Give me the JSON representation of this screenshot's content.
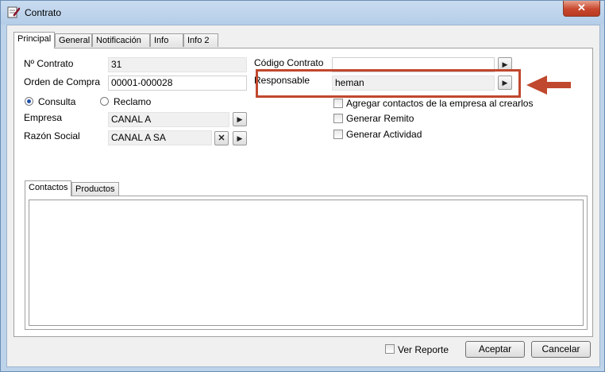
{
  "window": {
    "title": "Contrato",
    "close_glyph": "✕"
  },
  "tabs": [
    "Principal",
    "General",
    "Notificación",
    "Info",
    "Info 2"
  ],
  "fields": {
    "nro_contrato_label": "Nº Contrato",
    "nro_contrato_value": "31",
    "orden_compra_label": "Orden de Compra",
    "orden_compra_value": "00001-000028",
    "codigo_contrato_label": "Código Contrato",
    "codigo_contrato_value": "",
    "responsable_label": "Responsable",
    "responsable_value": "heman",
    "empresa_label": "Empresa",
    "empresa_value": "CANAL A",
    "razon_social_label": "Razón Social",
    "razon_social_value": "CANAL A SA"
  },
  "radios": {
    "consulta": "Consulta",
    "reclamo": "Reclamo",
    "selected": "consulta"
  },
  "checkboxes": {
    "agregar_contactos": "Agregar contactos de la empresa al crearlos",
    "generar_remito": "Generar Remito",
    "generar_actividad": "Generar Actividad"
  },
  "subtabs": [
    "Contactos",
    "Productos"
  ],
  "footer": {
    "ver_reporte": "Ver Reporte",
    "aceptar": "Aceptar",
    "cancelar": "Cancelar"
  },
  "icons": {
    "play": "▶",
    "clear": "✕"
  },
  "colors": {
    "highlight": "#c0482e"
  }
}
